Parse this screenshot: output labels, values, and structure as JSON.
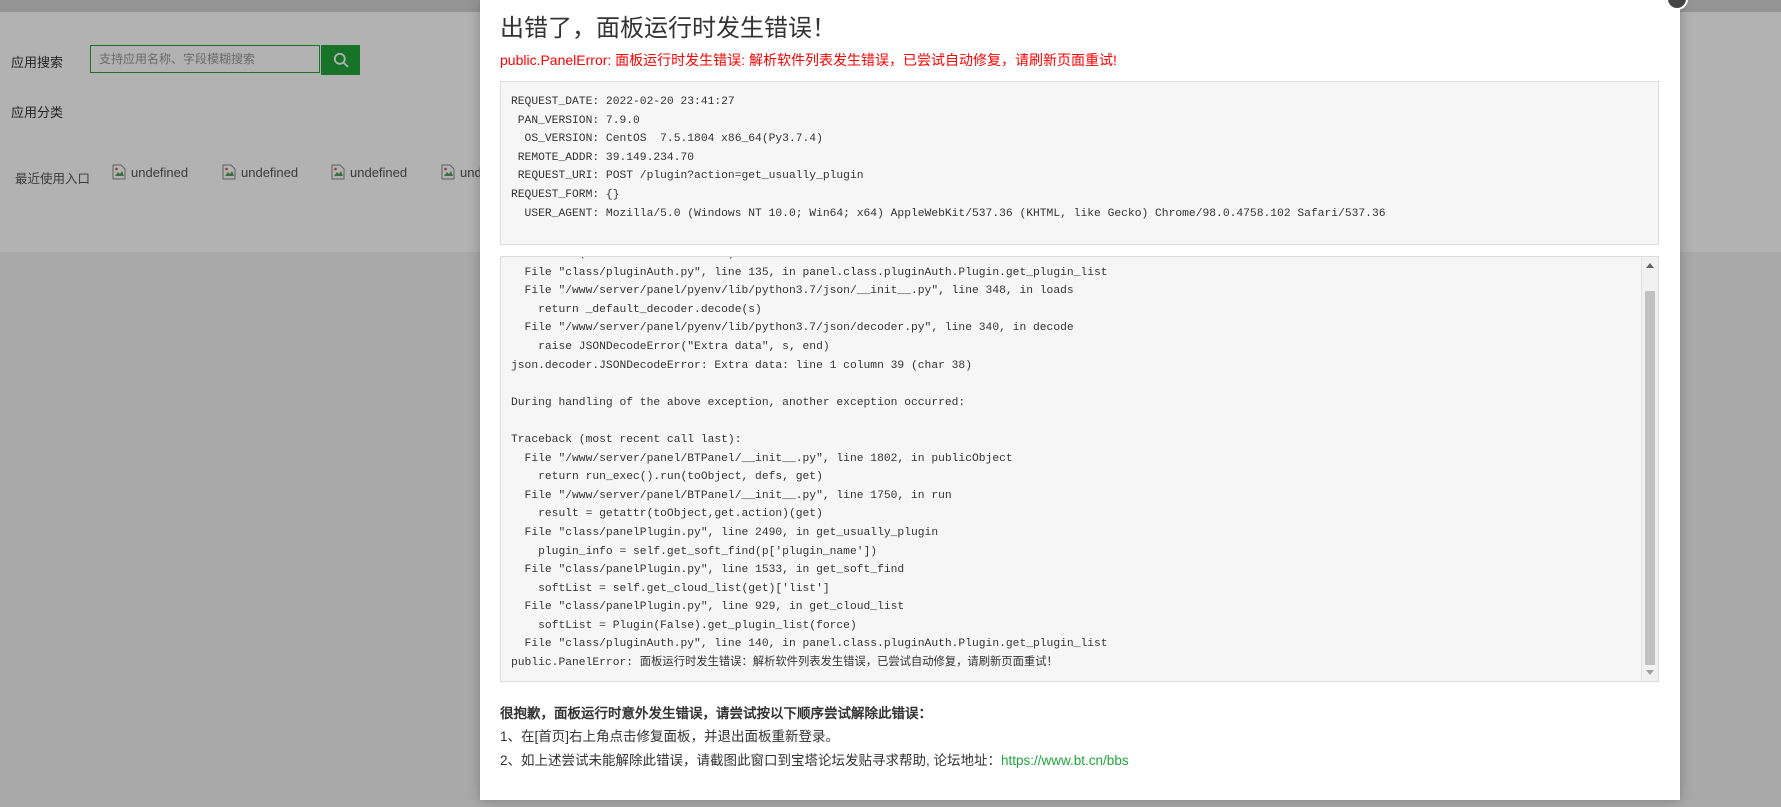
{
  "app": {
    "search_label": "应用搜索",
    "search_placeholder": "支持应用名称、字段模糊搜索",
    "category_label": "应用分类",
    "recent_label": "最近使用入口",
    "recent_items": [
      "undefined",
      "undefined",
      "undefined",
      "und"
    ]
  },
  "dialog": {
    "title": "出错了，面板运行时发生错误！",
    "subtitle": "public.PanelError: 面板运行时发生错误: 解析软件列表发生错误，已尝试自动修复，请刷新页面重试!",
    "info_lines": [
      "REQUEST_DATE: 2022-02-20 23:41:27",
      " PAN_VERSION: 7.9.0",
      "  OS_VERSION: CentOS  7.5.1804 x86_64(Py3.7.4)",
      " REMOTE_ADDR: 39.149.234.70",
      " REQUEST_URI: POST /plugin?action=get_usually_plugin",
      "REQUEST_FORM: {}",
      "  USER_AGENT: Mozilla/5.0 (Windows NT 10.0; Win64; x64) AppleWebKit/537.36 (KHTML, like Gecko) Chrome/98.0.4758.102 Safari/537.36"
    ],
    "traceback_lines": [
      "Traceback (most recent call last):",
      "  File \"class/pluginAuth.py\", line 135, in panel.class.pluginAuth.Plugin.get_plugin_list",
      "  File \"/www/server/panel/pyenv/lib/python3.7/json/__init__.py\", line 348, in loads",
      "    return _default_decoder.decode(s)",
      "  File \"/www/server/panel/pyenv/lib/python3.7/json/decoder.py\", line 340, in decode",
      "    raise JSONDecodeError(\"Extra data\", s, end)",
      "json.decoder.JSONDecodeError: Extra data: line 1 column 39 (char 38)",
      "",
      "During handling of the above exception, another exception occurred:",
      "",
      "Traceback (most recent call last):",
      "  File \"/www/server/panel/BTPanel/__init__.py\", line 1802, in publicObject",
      "    return run_exec().run(toObject, defs, get)",
      "  File \"/www/server/panel/BTPanel/__init__.py\", line 1750, in run",
      "    result = getattr(toObject,get.action)(get)",
      "  File \"class/panelPlugin.py\", line 2490, in get_usually_plugin",
      "    plugin_info = self.get_soft_find(p['plugin_name'])",
      "  File \"class/panelPlugin.py\", line 1533, in get_soft_find",
      "    softList = self.get_cloud_list(get)['list']",
      "  File \"class/panelPlugin.py\", line 929, in get_cloud_list",
      "    softList = Plugin(False).get_plugin_list(force)",
      "  File \"class/pluginAuth.py\", line 140, in panel.class.pluginAuth.Plugin.get_plugin_list",
      "public.PanelError: 面板运行时发生错误：解析软件列表发生错误，已尝试自动修复，请刷新页面重试！"
    ],
    "help_title": "很抱歉，面板运行时意外发生错误，请尝试按以下顺序尝试解除此错误：",
    "help_step1": "1、在[首页]右上角点击修复面板，并退出面板重新登录。",
    "help_step2_prefix": "2、如上述尝试未能解除此错误，请截图此窗口到宝塔论坛发贴寻求帮助, 论坛地址：",
    "forum_url": "https://www.bt.cn/bbs"
  },
  "colors": {
    "accent_green": "#20a53a",
    "error_red": "#ff0000"
  },
  "icons": {
    "search_button": "search-icon",
    "recent_item": "broken-image-icon",
    "close": "close-icon"
  }
}
